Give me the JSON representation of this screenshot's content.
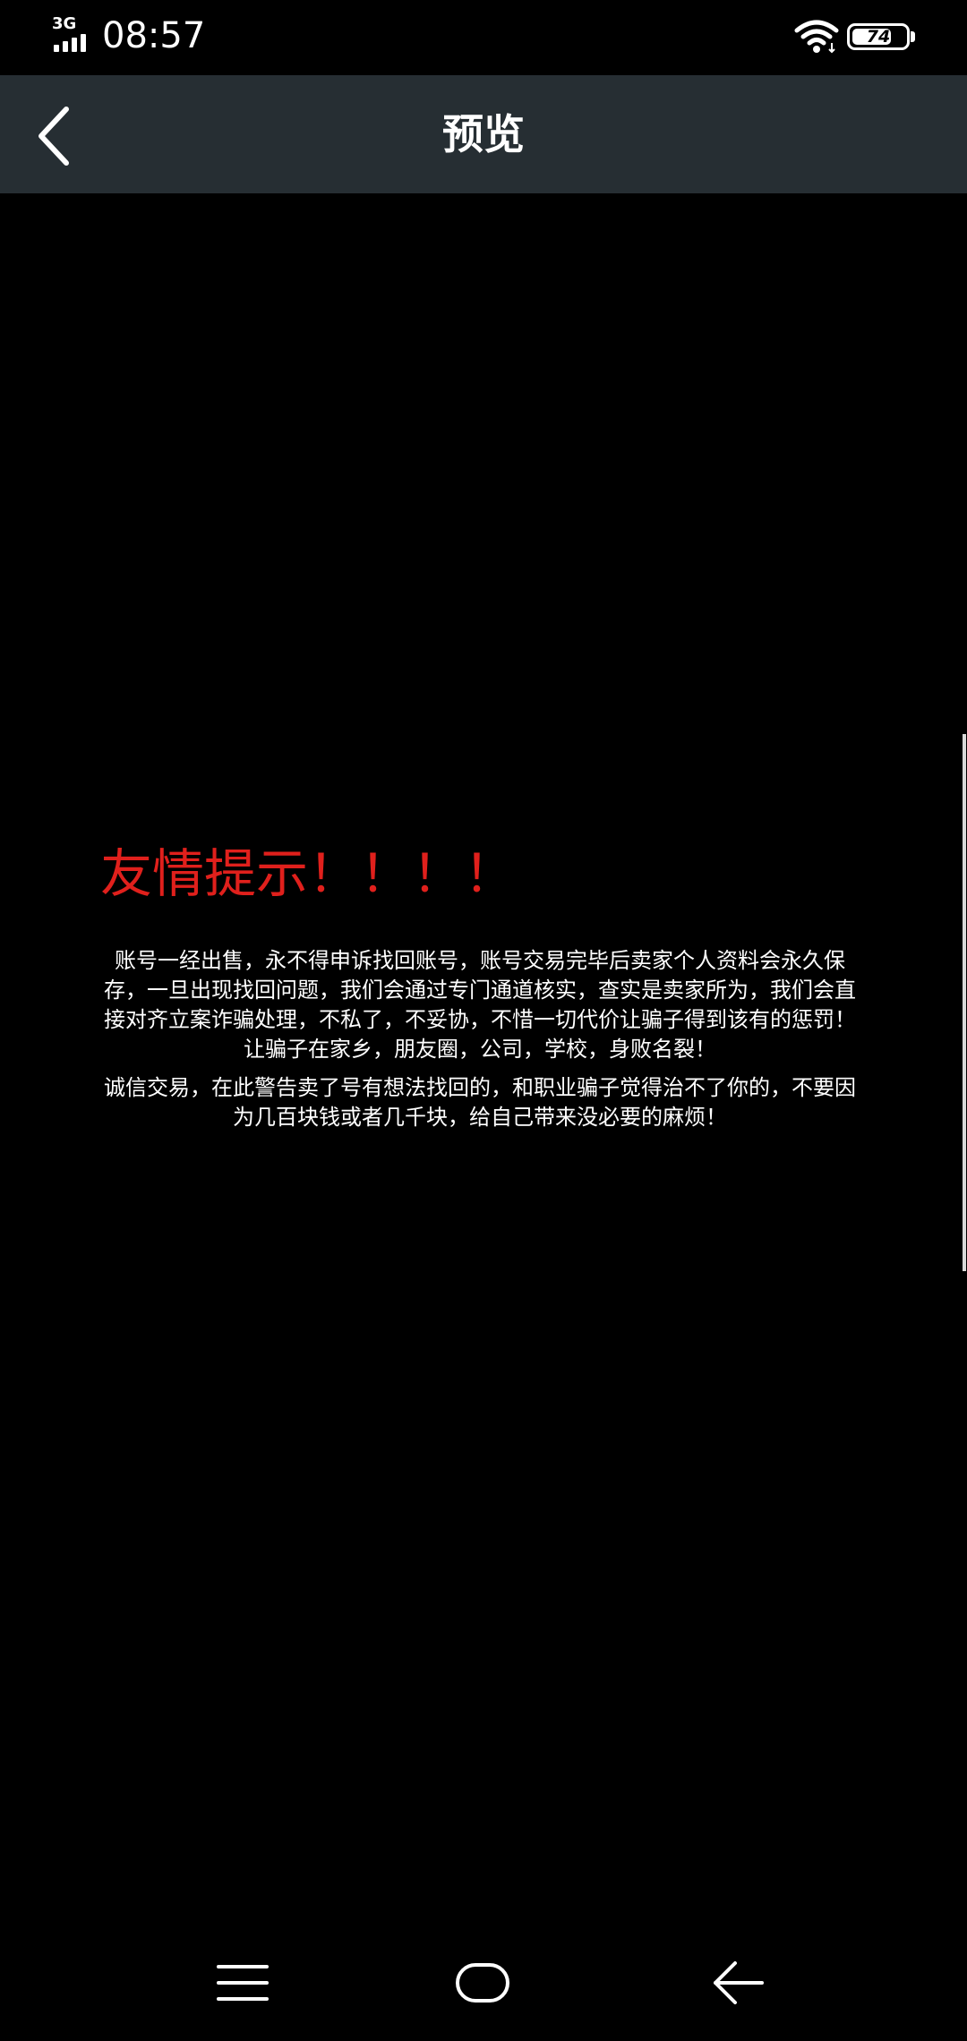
{
  "status_bar": {
    "network": "3G",
    "time": "08:57",
    "battery_level": "74",
    "battery_fraction": 0.74
  },
  "header": {
    "title": "预览"
  },
  "notice": {
    "title": "友情提示！！！！",
    "paragraphs": [
      "账号一经出售，永不得申诉找回账号，账号交易完毕后卖家个人资料会永久保存，一旦出现找回问题，我们会通过专门通道核实，查实是卖家所为，我们会直接对齐立案诈骗处理，不私了，不妥协，不惜一切代价让骗子得到该有的惩罚！让骗子在家乡，朋友圈，公司，学校，身败名裂！",
      "诚信交易，在此警告卖了号有想法找回的，和职业骗子觉得治不了你的，不要因为几百块钱或者几千块，给自己带来没必要的麻烦！"
    ]
  },
  "colors": {
    "header_bg": "#262e33",
    "notice_title": "#e0201c",
    "background": "#000000"
  },
  "icons": {
    "back": "chevron-left-icon",
    "wifi": "wifi-icon",
    "battery": "battery-icon",
    "signal": "signal-icon",
    "nav_menu": "menu-icon",
    "nav_home": "home-icon",
    "nav_back": "arrow-left-icon"
  }
}
